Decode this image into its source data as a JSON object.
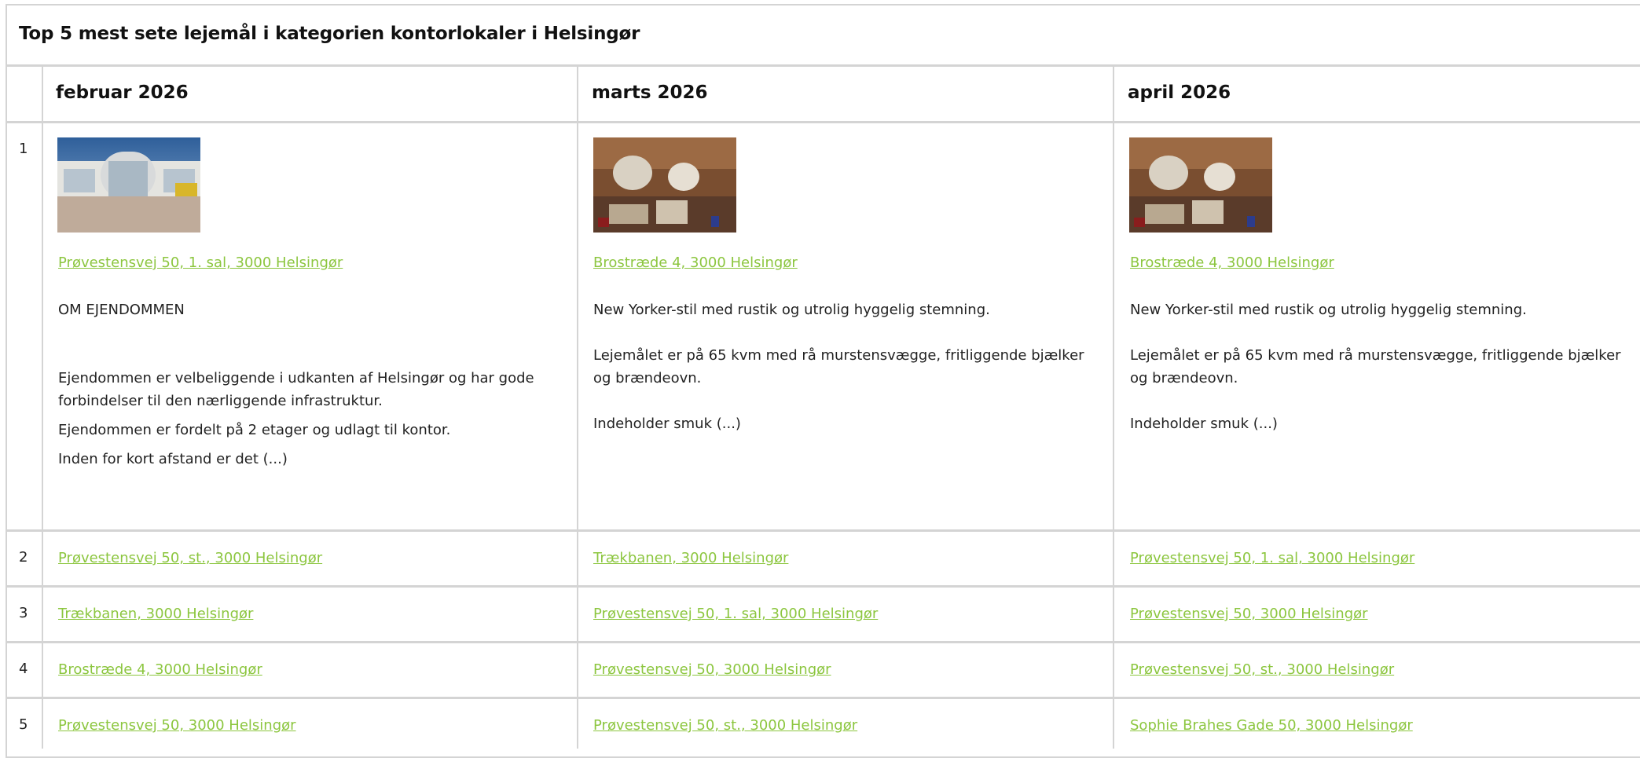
{
  "widget": {
    "title": "Top 5 mest sete lejemål i kategorien kontorlokaler i Helsingør",
    "months": [
      "februar 2026",
      "marts 2026",
      "april 2026"
    ],
    "ranks": [
      "1",
      "2",
      "3",
      "4",
      "5"
    ]
  },
  "featured": [
    {
      "image": "office-building-photo",
      "link": "Prøvestensvej 50, 1. sal, 3000 Helsingør",
      "paragraphs": [
        "OM EJENDOMMEN",
        "Ejendommen er velbeliggende i udkanten af Helsingør og har gode forbindelser til den nærliggende infrastruktur.",
        "Ejendommen er fordelt på 2 etager og udlagt til kontor.",
        "Inden for kort afstand er det (...)"
      ]
    },
    {
      "image": "rustic-interior-photo",
      "link": "Brostræde 4, 3000 Helsingør",
      "paragraphs": [
        "New Yorker-stil med rustik og utrolig hyggelig stemning.",
        "Lejemålet er på 65 kvm med rå murstensvægge, fritliggende bjælker og brændeovn.",
        "Indeholder smuk (...)"
      ]
    },
    {
      "image": "rustic-interior-photo",
      "link": "Brostræde 4, 3000 Helsingør",
      "paragraphs": [
        "New Yorker-stil med rustik og utrolig hyggelig stemning.",
        "Lejemålet er på 65 kvm med rå murstensvægge, fritliggende bjælker og brændeovn.",
        "Indeholder smuk (...)"
      ]
    }
  ],
  "rows": [
    [
      "Prøvestensvej 50, st., 3000 Helsingør",
      "Trækbanen, 3000 Helsingør",
      "Prøvestensvej 50, 1. sal, 3000 Helsingør"
    ],
    [
      "Trækbanen, 3000 Helsingør",
      "Prøvestensvej 50, 1. sal, 3000 Helsingør",
      "Prøvestensvej 50, 3000 Helsingør"
    ],
    [
      "Brostræde 4, 3000 Helsingør",
      "Prøvestensvej 50, 3000 Helsingør",
      "Prøvestensvej 50, st., 3000 Helsingør"
    ],
    [
      "Prøvestensvej 50, 3000 Helsingør",
      "Prøvestensvej 50, st., 3000 Helsingør",
      "Sophie Brahes Gade 50, 3000 Helsingør"
    ]
  ],
  "colors": {
    "link": "#8cc63f",
    "border": "#d4d4d4"
  }
}
